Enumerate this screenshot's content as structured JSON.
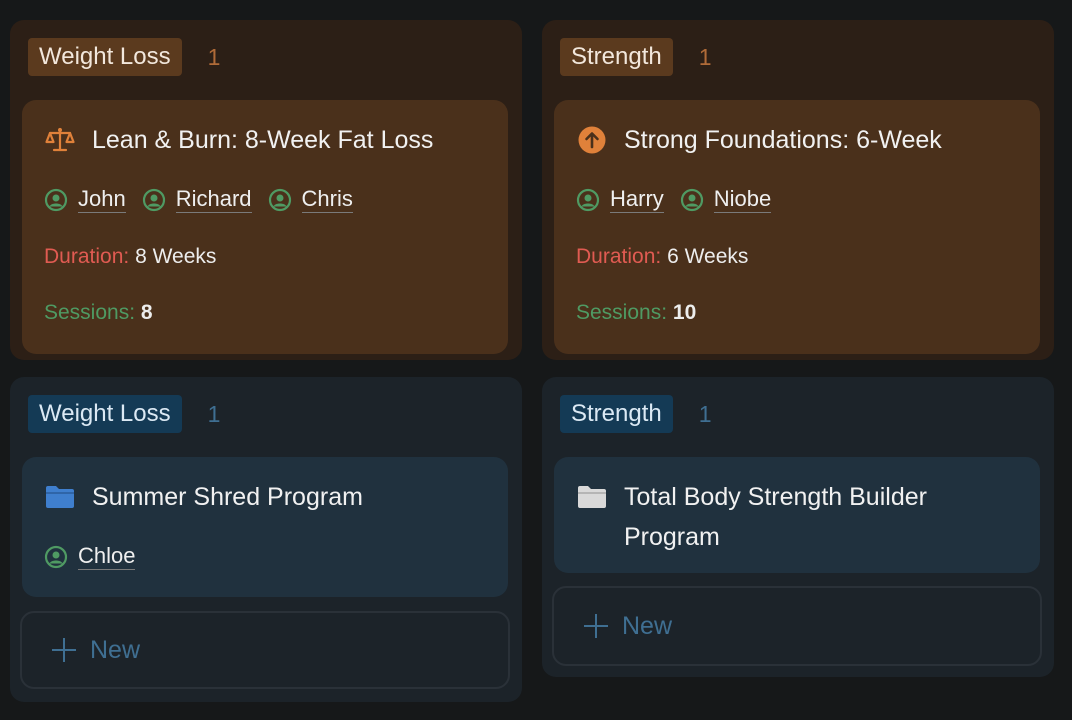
{
  "board": {
    "top_left": {
      "group_label": "Weight Loss",
      "count": "1",
      "card": {
        "icon": "scale-icon",
        "title": "Lean & Burn: 8-Week Fat Loss",
        "people": [
          "John",
          "Richard",
          "Chris"
        ],
        "duration_label": "Duration:",
        "duration_value": "8 Weeks",
        "sessions_label": "Sessions:",
        "sessions_value": "8"
      }
    },
    "top_right": {
      "group_label": "Strength",
      "count": "1",
      "card": {
        "icon": "arrow-up-circle-icon",
        "title": "Strong Foundations: 6-Week",
        "people": [
          "Harry",
          "Niobe"
        ],
        "duration_label": "Duration:",
        "duration_value": "6 Weeks",
        "sessions_label": "Sessions:",
        "sessions_value": "10"
      }
    },
    "bottom_left": {
      "group_label": "Weight Loss",
      "count": "1",
      "card": {
        "icon": "folder-icon",
        "title": "Summer Shred Program",
        "people": [
          "Chloe"
        ]
      },
      "new_label": "New"
    },
    "bottom_right": {
      "group_label": "Strength",
      "count": "1",
      "card": {
        "icon": "folder-icon",
        "title_line1": "Total Body Strength Builder",
        "title_line2": "Program"
      },
      "new_label": "New"
    }
  },
  "colors": {
    "brown_tag": "#5b3a1e",
    "blue_tag": "#143a55",
    "duration_label": "#e05b52",
    "sessions_label": "#4f9a63",
    "person_icon": "#4f9a63"
  }
}
